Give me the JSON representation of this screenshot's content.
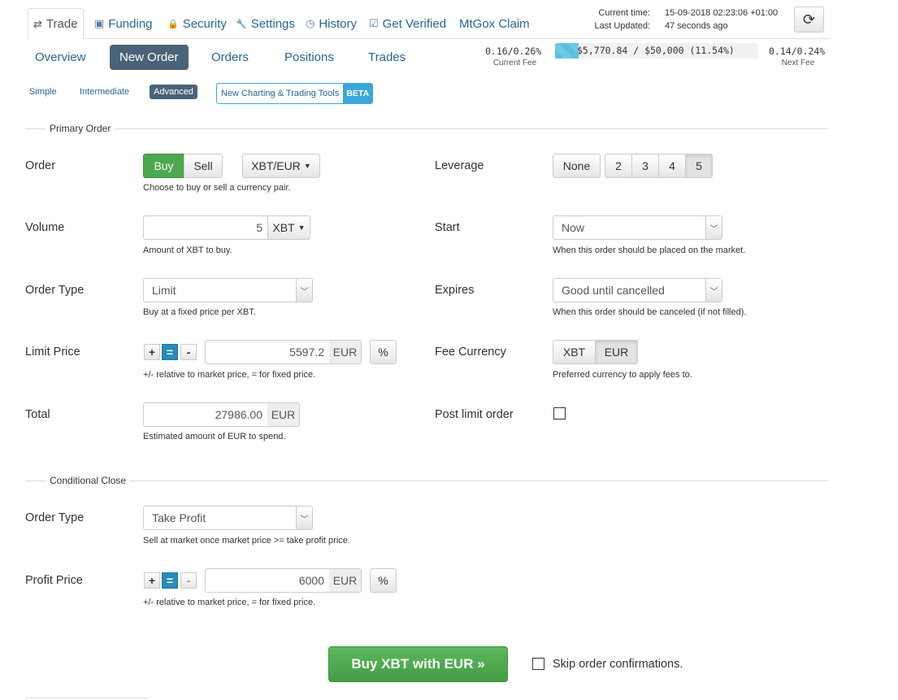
{
  "top_tabs": [
    {
      "label": "Trade",
      "icon": "⇄"
    },
    {
      "label": "Funding",
      "icon": "▣"
    },
    {
      "label": "Security",
      "icon": "🔒"
    },
    {
      "label": "Settings",
      "icon": "🔧"
    },
    {
      "label": "History",
      "icon": "◷"
    },
    {
      "label": "Get Verified",
      "icon": "☑"
    },
    {
      "label": "MtGox Claim",
      "icon": ""
    }
  ],
  "status": {
    "current_time_label": "Current time:",
    "current_time": "15-09-2018 02:23:06 +01:00",
    "last_updated_label": "Last Updated:",
    "last_updated": "47 seconds ago"
  },
  "sub_nav": [
    "Overview",
    "New Order",
    "Orders",
    "Positions",
    "Trades"
  ],
  "fees": {
    "current": "0.16/0.26%",
    "current_label": "Current Fee",
    "volume_text": "$5,770.84 / $50,000 (11.54%)",
    "volume_fraction": 0.1154,
    "next": "0.14/0.24%",
    "next_label": "Next Fee"
  },
  "modes": [
    "Simple",
    "Intermediate",
    "Advanced"
  ],
  "new_tools": {
    "label": "New Charting & Trading Tools",
    "badge": "BETA"
  },
  "primary_order": {
    "title": "Primary Order",
    "order": {
      "label": "Order",
      "buy": "Buy",
      "sell": "Sell",
      "pair": "XBT/EUR",
      "help": "Choose to buy or sell a currency pair."
    },
    "leverage": {
      "label": "Leverage",
      "options": [
        "None",
        "2",
        "3",
        "4",
        "5"
      ],
      "selected": "5"
    },
    "volume": {
      "label": "Volume",
      "value": "5",
      "unit": "XBT",
      "help": "Amount of XBT to buy."
    },
    "start": {
      "label": "Start",
      "value": "Now",
      "help": "When this order should be placed on the market."
    },
    "order_type": {
      "label": "Order Type",
      "value": "Limit",
      "help": "Buy at a fixed price per XBT."
    },
    "expires": {
      "label": "Expires",
      "value": "Good until cancelled",
      "help": "When this order should be canceled (if not filled)."
    },
    "limit_price": {
      "label": "Limit Price",
      "plus": "+",
      "equals": "=",
      "minus": "-",
      "value": "5597.2",
      "unit": "EUR",
      "pct": "%",
      "help": "+/- relative to market price, = for fixed price."
    },
    "fee_currency": {
      "label": "Fee Currency",
      "options": [
        "XBT",
        "EUR"
      ],
      "selected": "EUR",
      "help": "Preferred currency to apply fees to."
    },
    "total": {
      "label": "Total",
      "value": "27986.00",
      "unit": "EUR",
      "help": "Estimated amount of EUR to spend."
    },
    "post_limit": {
      "label": "Post limit order"
    }
  },
  "conditional_close": {
    "title": "Conditional Close",
    "order_type": {
      "label": "Order Type",
      "value": "Take Profit",
      "help": "Sell at market once market price >= take profit price."
    },
    "profit_price": {
      "label": "Profit Price",
      "plus": "+",
      "equals": "=",
      "minus": "-",
      "value": "6000",
      "unit": "EUR",
      "pct": "%",
      "help": "+/- relative to market price, = for fixed price."
    }
  },
  "submit": {
    "label": "Buy XBT with EUR »",
    "skip_label": "Skip order confirmations."
  }
}
